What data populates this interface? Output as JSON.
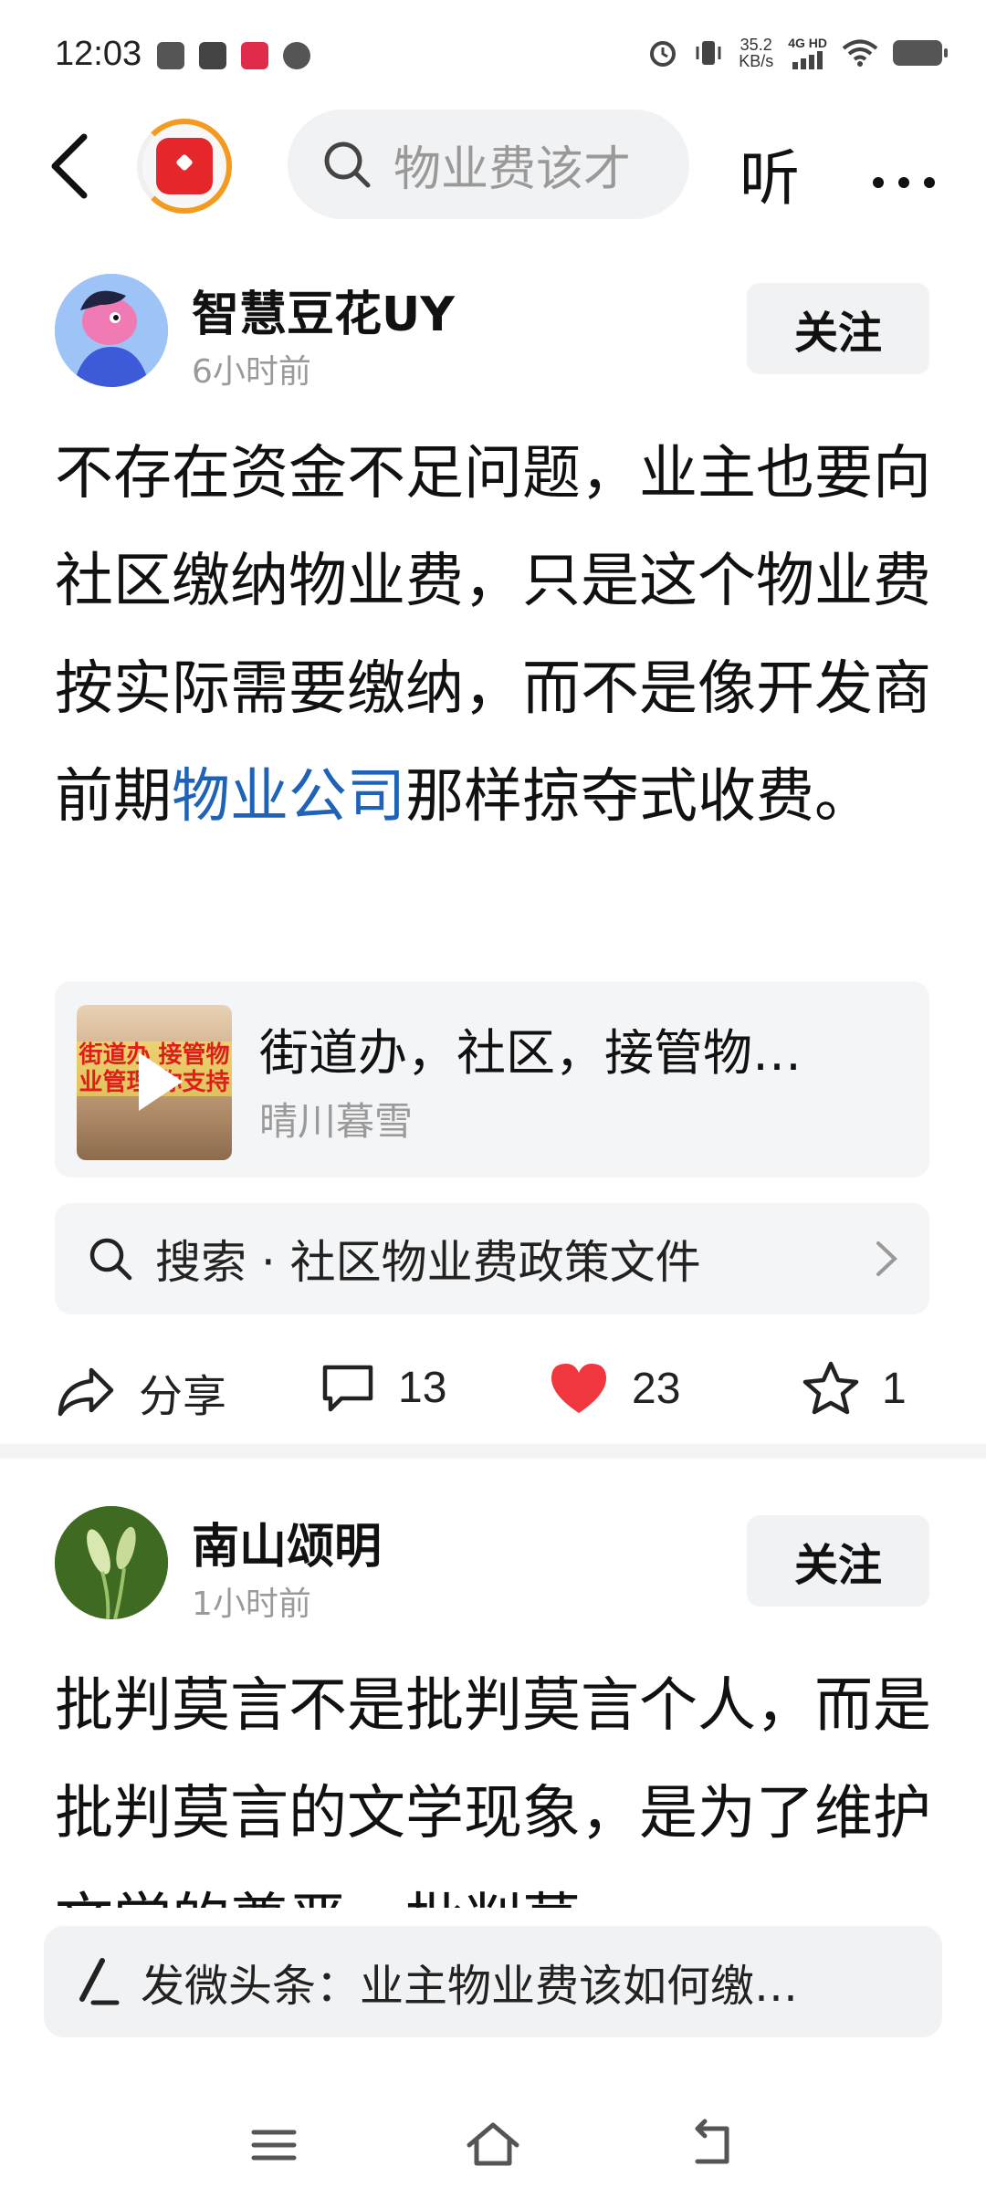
{
  "status_bar": {
    "time": "12:03",
    "net_speed_value": "35.2",
    "net_speed_unit": "KB/s",
    "net_type": "4G HD"
  },
  "top_nav": {
    "search_placeholder": "物业费该才",
    "listen_label": "听"
  },
  "posts": [
    {
      "author": "智慧豆花UY",
      "time": "6小时前",
      "follow_label": "关注",
      "body_before_link": "不存在资金不足问题，业主也要向社区缴纳物业费，只是这个物业费按实际需要缴纳，而不是像开发商前期",
      "body_link": "物业公司",
      "body_after_link": "那样掠夺式收费。",
      "video": {
        "title": "街道办，社区，接管物…",
        "author": "晴川暮雪",
        "thumb_text": "街道办 接管物业管理 你支持"
      },
      "search_suggest": "搜索 · 社区物业费政策文件",
      "actions": {
        "share_label": "分享",
        "comments": "13",
        "likes": "23",
        "favorites": "1"
      }
    },
    {
      "author": "南山颂明",
      "time": "1小时前",
      "follow_label": "关注",
      "body": "批判莫言不是批判莫言个人，而是批判莫言的文学现象，是为了维护文学的尊严，批判莫"
    }
  ],
  "publish_bar": {
    "text": "发微头条：业主物业费该如何缴…"
  },
  "colors": {
    "link": "#1f63b8",
    "like": "#f0373e",
    "background": "#ffffff",
    "card": "#f4f5f7"
  }
}
